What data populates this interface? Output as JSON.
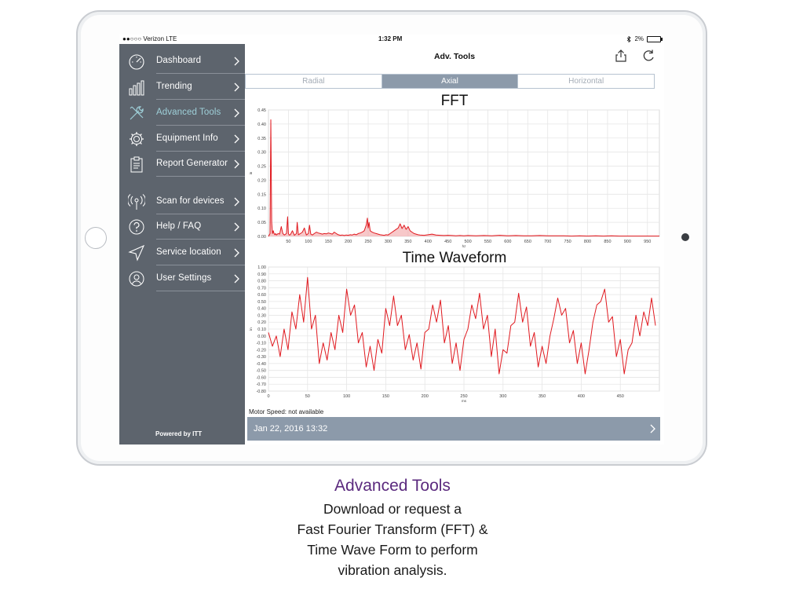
{
  "status_bar": {
    "carrier": "●●○○○ Verizon  LTE",
    "time": "1:32 PM",
    "battery": "2%"
  },
  "sidebar": {
    "items": [
      {
        "label": "Dashboard",
        "icon": "gauge-icon"
      },
      {
        "label": "Trending",
        "icon": "bar-chart-icon"
      },
      {
        "label": "Advanced Tools",
        "icon": "tools-icon",
        "active": true
      },
      {
        "label": "Equipment Info",
        "icon": "gear-icon"
      },
      {
        "label": "Report Generator",
        "icon": "clipboard-icon"
      },
      {
        "label": "Scan for devices",
        "icon": "broadcast-icon"
      },
      {
        "label": "Help / FAQ",
        "icon": "question-icon"
      },
      {
        "label": "Service location",
        "icon": "location-arrow-icon"
      },
      {
        "label": "User Settings",
        "icon": "user-icon"
      }
    ],
    "footer": "Powered by ITT"
  },
  "header": {
    "title": "Adv. Tools",
    "share_icon": "share-icon",
    "refresh_icon": "refresh-icon"
  },
  "tabs": [
    {
      "label": "Radial",
      "active": false
    },
    {
      "label": "Axial",
      "active": true
    },
    {
      "label": "Horizontal",
      "active": false
    }
  ],
  "motor_speed": "Motor Speed: not available",
  "reading_date": "Jan 22, 2016 13:32",
  "colors": {
    "sidebar": "#5d646d",
    "accent_tab": "#8c9aaa",
    "active_label": "#9ecfd8",
    "trace": "#e0191f",
    "caption_title": "#5b2a7e"
  },
  "caption": {
    "title": "Advanced Tools",
    "lines": [
      "Download or request a",
      "Fast Fourier Transform (FFT) &",
      "Time Wave Form to perform",
      "vibration analysis."
    ]
  },
  "chart_data": [
    {
      "type": "line",
      "title": "FFT",
      "xlabel": "hz",
      "ylabel": "in",
      "xlim": [
        0,
        980
      ],
      "ylim": [
        0,
        0.45
      ],
      "x_ticks": [
        50,
        100,
        150,
        200,
        250,
        300,
        350,
        400,
        450,
        500,
        550,
        600,
        650,
        700,
        750,
        800,
        850,
        900,
        950
      ],
      "y_ticks": [
        0.0,
        0.05,
        0.1,
        0.15,
        0.2,
        0.25,
        0.3,
        0.35,
        0.4,
        0.45
      ],
      "y_tick_labels": [
        "0.00",
        "0.05",
        "0.10",
        "0.15",
        "0.20",
        "0.25",
        "0.30",
        "0.35",
        "0.40",
        "0.45"
      ],
      "grid": true,
      "series": [
        {
          "x": [
            0,
            4,
            6,
            8,
            10,
            12,
            14,
            16,
            18,
            20,
            24,
            28,
            32,
            36,
            40,
            45,
            48,
            50,
            52,
            55,
            60,
            65,
            70,
            72,
            75,
            80,
            85,
            90,
            95,
            100,
            103,
            106,
            110,
            115,
            120,
            125,
            130,
            135,
            140,
            145,
            150,
            155,
            160,
            165,
            170,
            175,
            180,
            185,
            190,
            195,
            200,
            205,
            210,
            215,
            220,
            225,
            230,
            235,
            240,
            245,
            248,
            250,
            252,
            255,
            260,
            265,
            270,
            275,
            280,
            285,
            290,
            295,
            300,
            305,
            310,
            315,
            320,
            325,
            330,
            335,
            340,
            345,
            350,
            355,
            360,
            365,
            370,
            375,
            380,
            390,
            400,
            410,
            420,
            430,
            440,
            450,
            460,
            470,
            480,
            490,
            500,
            520,
            540,
            560,
            580,
            600,
            620,
            640,
            660,
            680,
            700,
            720,
            740,
            760,
            780,
            800,
            820,
            840,
            860,
            880,
            900,
            920,
            940,
            960,
            980
          ],
          "y": [
            0.0,
            0.01,
            0.415,
            0.05,
            0.01,
            0.02,
            0.01,
            0.006,
            0.01,
            0.005,
            0.01,
            0.008,
            0.035,
            0.01,
            0.005,
            0.01,
            0.07,
            0.01,
            0.005,
            0.006,
            0.02,
            0.004,
            0.01,
            0.05,
            0.006,
            0.01,
            0.015,
            0.03,
            0.005,
            0.01,
            0.04,
            0.008,
            0.005,
            0.01,
            0.015,
            0.012,
            0.01,
            0.008,
            0.01,
            0.009,
            0.012,
            0.01,
            0.008,
            0.015,
            0.01,
            0.006,
            0.004,
            0.005,
            0.003,
            0.005,
            0.004,
            0.006,
            0.005,
            0.008,
            0.006,
            0.01,
            0.012,
            0.015,
            0.02,
            0.04,
            0.065,
            0.03,
            0.05,
            0.02,
            0.015,
            0.012,
            0.01,
            0.008,
            0.006,
            0.005,
            0.004,
            0.006,
            0.005,
            0.01,
            0.015,
            0.02,
            0.025,
            0.03,
            0.045,
            0.028,
            0.04,
            0.025,
            0.035,
            0.02,
            0.015,
            0.01,
            0.008,
            0.006,
            0.005,
            0.004,
            0.006,
            0.008,
            0.005,
            0.004,
            0.003,
            0.004,
            0.003,
            0.002,
            0.003,
            0.002,
            0.003,
            0.002,
            0.003,
            0.002,
            0.004,
            0.002,
            0.003,
            0.002,
            0.002,
            0.003,
            0.002,
            0.002,
            0.002,
            0.001,
            0.002,
            0.001,
            0.002,
            0.001,
            0.002,
            0.001,
            0.001,
            0.001,
            0.001,
            0.001,
            0.001
          ]
        }
      ]
    },
    {
      "type": "line",
      "title": "Time Waveform",
      "xlabel": "ms",
      "ylabel": "in",
      "xlim": [
        0,
        500
      ],
      "ylim": [
        -0.8,
        1.0
      ],
      "x_ticks": [
        0,
        50,
        100,
        150,
        200,
        250,
        300,
        350,
        400,
        450
      ],
      "y_ticks": [
        -0.8,
        -0.7,
        -0.6,
        -0.5,
        -0.4,
        -0.3,
        -0.2,
        -0.1,
        0.0,
        0.1,
        0.2,
        0.3,
        0.4,
        0.5,
        0.6,
        0.7,
        0.8,
        0.9,
        1.0
      ],
      "y_tick_labels": [
        "-0.80",
        "-0.70",
        "-0.60",
        "-0.50",
        "-0.40",
        "-0.30",
        "-0.20",
        "-0.10",
        "0.00",
        "0.10",
        "0.20",
        "0.30",
        "0.40",
        "0.50",
        "0.60",
        "0.70",
        "0.80",
        "0.90",
        "1.00"
      ],
      "grid": true,
      "series": [
        {
          "x": [
            0,
            5,
            10,
            15,
            20,
            25,
            30,
            35,
            40,
            45,
            50,
            55,
            60,
            65,
            70,
            75,
            80,
            85,
            90,
            95,
            100,
            105,
            110,
            115,
            120,
            125,
            130,
            135,
            140,
            145,
            150,
            155,
            160,
            165,
            170,
            175,
            180,
            185,
            190,
            195,
            200,
            205,
            210,
            215,
            220,
            225,
            230,
            235,
            240,
            245,
            250,
            255,
            260,
            265,
            270,
            275,
            280,
            285,
            290,
            295,
            300,
            305,
            310,
            315,
            320,
            325,
            330,
            335,
            340,
            345,
            350,
            355,
            360,
            365,
            370,
            375,
            380,
            385,
            390,
            395,
            400,
            405,
            410,
            415,
            420,
            425,
            430,
            435,
            440,
            445,
            450,
            455,
            460,
            465,
            470,
            475,
            480,
            485,
            490,
            495
          ],
          "y": [
            0.05,
            -0.15,
            0.0,
            -0.3,
            0.1,
            -0.2,
            0.35,
            0.1,
            0.6,
            0.2,
            0.85,
            0.1,
            0.3,
            -0.4,
            -0.1,
            -0.35,
            0.05,
            -0.2,
            0.3,
            0.05,
            0.68,
            0.3,
            0.45,
            -0.1,
            0.05,
            -0.45,
            -0.15,
            -0.5,
            -0.05,
            -0.25,
            0.4,
            0.15,
            0.58,
            0.15,
            0.3,
            -0.2,
            0.02,
            -0.35,
            -0.1,
            -0.48,
            0.05,
            0.1,
            0.45,
            0.2,
            0.52,
            -0.1,
            0.15,
            -0.4,
            -0.1,
            -0.5,
            -0.05,
            0.1,
            0.45,
            0.25,
            0.62,
            0.1,
            0.3,
            -0.3,
            0.1,
            -0.55,
            -0.2,
            -0.25,
            0.15,
            0.2,
            0.62,
            0.2,
            0.42,
            -0.15,
            0.05,
            -0.45,
            -0.15,
            -0.4,
            0.0,
            0.25,
            0.55,
            0.3,
            0.4,
            -0.1,
            0.08,
            -0.4,
            -0.1,
            -0.55,
            -0.2,
            0.2,
            0.45,
            0.5,
            0.68,
            0.2,
            0.28,
            -0.3,
            -0.05,
            -0.55,
            -0.2,
            -0.1,
            0.3,
            0.0,
            0.35,
            0.15,
            0.55,
            0.15
          ]
        }
      ]
    }
  ]
}
